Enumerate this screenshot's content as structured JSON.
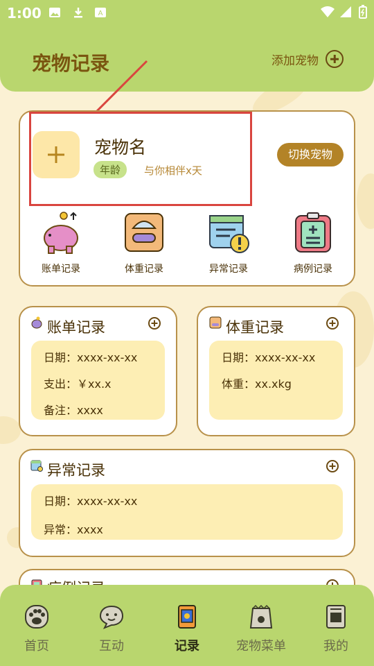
{
  "status": {
    "time": "1:00"
  },
  "header": {
    "title": "宠物记录",
    "add_pet_label": "添加宠物"
  },
  "pet": {
    "name": "宠物名",
    "age_label": "年龄",
    "companion_text": "与你相伴x天",
    "switch_label": "切换宠物"
  },
  "quick_actions": [
    {
      "label": "账单记录",
      "icon": "piggy-bank-icon"
    },
    {
      "label": "体重记录",
      "icon": "scale-icon"
    },
    {
      "label": "异常记录",
      "icon": "calendar-alert-icon"
    },
    {
      "label": "病例记录",
      "icon": "medical-clipboard-icon"
    }
  ],
  "bill_record": {
    "title": "账单记录",
    "date": "日期：xxxx-xx-xx",
    "expense": "支出：￥xx.x",
    "note": "备注：xxxx"
  },
  "weight_record": {
    "title": "体重记录",
    "date": "日期：xxxx-xx-xx",
    "weight": "体重：xx.xkg"
  },
  "abnormal_record": {
    "title": "异常记录",
    "date": "日期：xxxx-xx-xx",
    "abnormal": "异常：xxxx"
  },
  "case_record": {
    "title": "病例记录"
  },
  "nav": [
    {
      "label": "首页",
      "icon": "paw-icon",
      "active": false
    },
    {
      "label": "互动",
      "icon": "chat-icon",
      "active": false
    },
    {
      "label": "记录",
      "icon": "record-book-icon",
      "active": true
    },
    {
      "label": "宠物菜单",
      "icon": "food-bag-icon",
      "active": false
    },
    {
      "label": "我的",
      "icon": "profile-icon",
      "active": false
    }
  ],
  "colors": {
    "header": "#b9d66e",
    "accent": "#b38327",
    "highlight": "#d9453f",
    "card_border": "#b8914a",
    "background": "#fbf1d4"
  }
}
